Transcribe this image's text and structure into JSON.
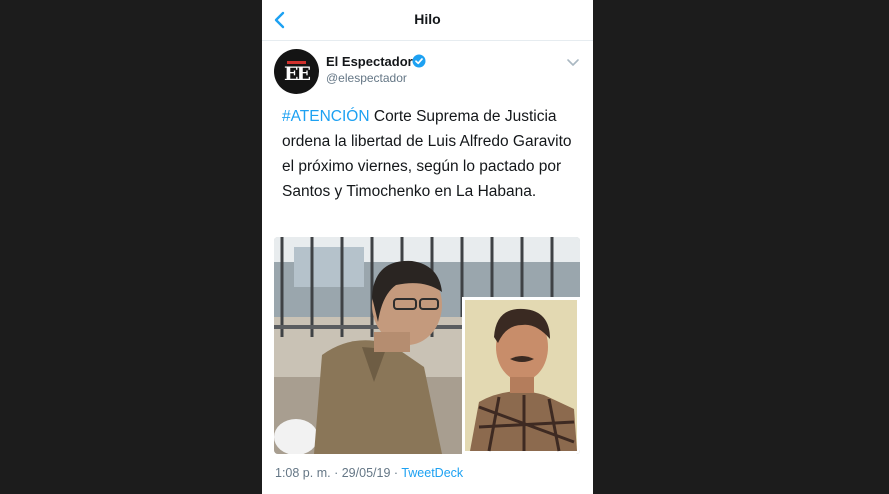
{
  "header": {
    "title": "Hilo",
    "back_icon": "chevron-left-icon"
  },
  "tweet": {
    "author_name": "El Espectador",
    "author_handle": "@elespectador",
    "avatar_text": "EE",
    "verified": true,
    "hashtag": "#ATENCIÓN",
    "text": " Corte Suprema de Justicia ordena la libertad de Luis Alfredo Garavito el próximo viernes, según lo pactado por Santos y Timochenko en La Habana.",
    "time": "1:08 p. m.",
    "separator": "·",
    "date": "29/05/19",
    "client": "TweetDeck"
  },
  "colors": {
    "accent": "#1da1f2",
    "text": "#14171a",
    "muted": "#657786",
    "background": "#1c1c1c"
  }
}
